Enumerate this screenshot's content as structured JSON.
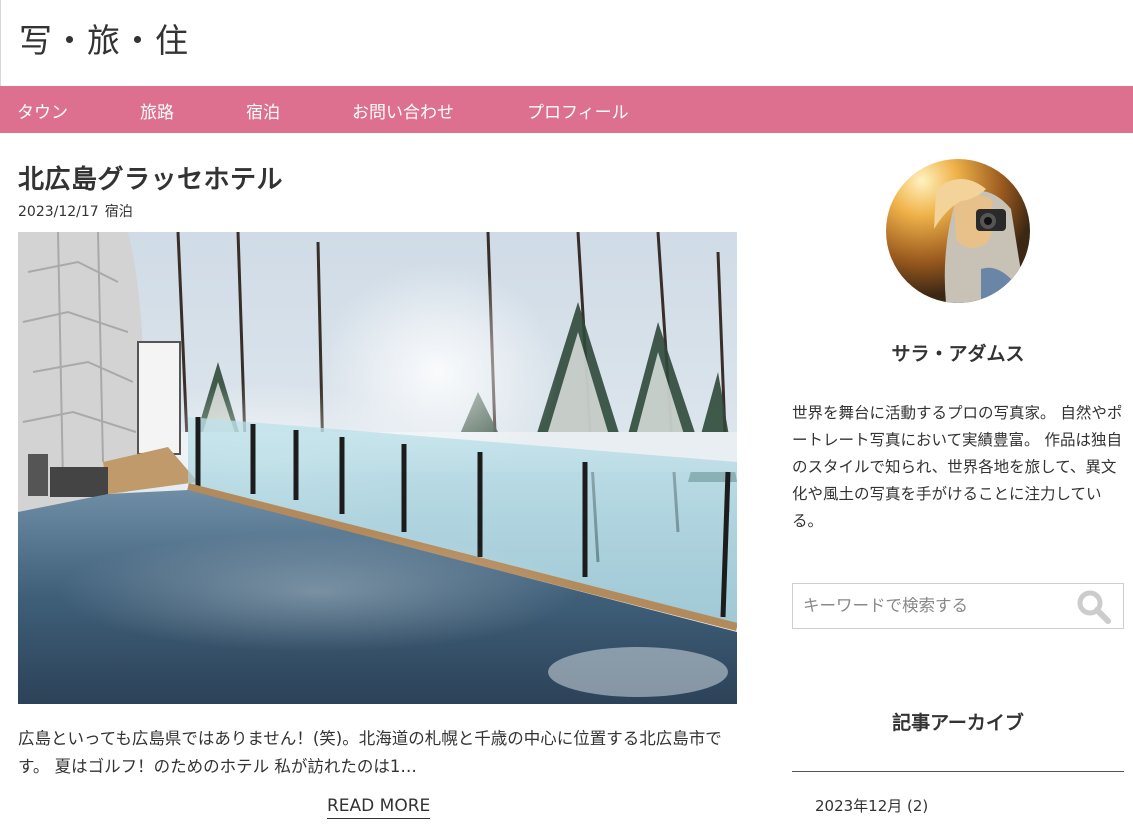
{
  "site": {
    "title": "写・旅・住"
  },
  "nav": {
    "items": [
      "タウン",
      "旅路",
      "宿泊",
      "お問い合わせ",
      "プロフィール"
    ]
  },
  "post": {
    "title": "北広島グラッセホテル",
    "date": "2023/12/17",
    "category": "宿泊",
    "excerpt": "広島といっても広島県ではありません！(笑)。北海道の札幌と千歳の中心に位置する北広島市です。 夏はゴルフ！のためのホテル 私が訪れたのは1…",
    "read_more": "READ MORE"
  },
  "sidebar": {
    "profile": {
      "name": "サラ・アダムス",
      "bio": "世界を舞台に活動するプロの写真家。 自然やポートレート写真において実績豊富。 作品は独自のスタイルで知られ、世界各地を旅して、異文化や風土の写真を手がけることに注力している。"
    },
    "search": {
      "placeholder": "キーワードで検索する",
      "icon": "search-icon"
    },
    "archive": {
      "title": "記事アーカイブ",
      "items": [
        {
          "label": "2023年12月 (2)"
        }
      ]
    }
  },
  "colors": {
    "nav_bg": "#dd6f8f",
    "text": "#333333"
  }
}
